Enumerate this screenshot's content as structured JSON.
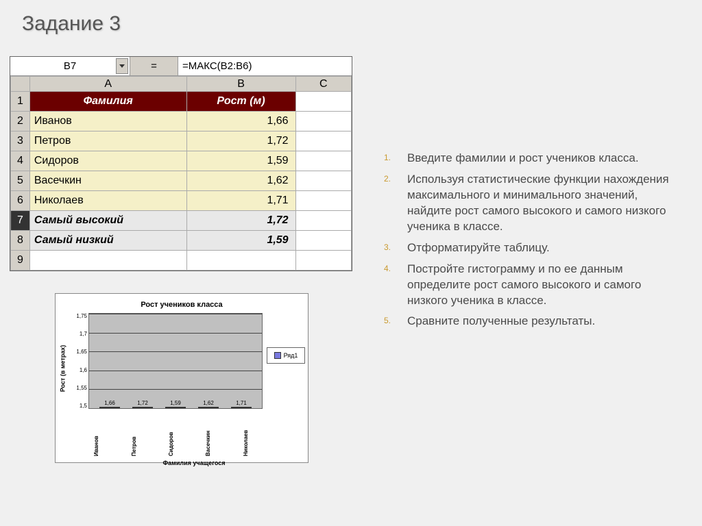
{
  "title": "Задание 3",
  "excel": {
    "active_cell": "B7",
    "eq_sign": "=",
    "formula": "=МАКС(B2:B6)",
    "cols": [
      "A",
      "B",
      "C"
    ],
    "header": {
      "A": "Фамилия",
      "B": "Рост (м)"
    },
    "rows": [
      {
        "num": "1"
      },
      {
        "num": "2",
        "A": "Иванов",
        "B": "1,66"
      },
      {
        "num": "3",
        "A": "Петров",
        "B": "1,72"
      },
      {
        "num": "4",
        "A": "Сидоров",
        "B": "1,59"
      },
      {
        "num": "5",
        "A": "Васечкин",
        "B": "1,62"
      },
      {
        "num": "6",
        "A": "Николаев",
        "B": "1,71"
      },
      {
        "num": "7",
        "A": "Самый высокий",
        "B": "1,72",
        "summary": true,
        "selected": true
      },
      {
        "num": "8",
        "A": "Самый низкий",
        "B": "1,59",
        "summary": true
      },
      {
        "num": "9"
      }
    ]
  },
  "instructions": [
    "Введите фамилии и рост учеников класса.",
    "Используя статистические функции нахождения максимального и минимального значений, найдите рост самого высокого и самого низкого ученика в классе.",
    "Отформатируйте таблицу.",
    "Постройте гистограмму и по ее данным определите рост самого высокого и самого низкого ученика в классе.",
    "Сравните полученные результаты."
  ],
  "instruction_nums": [
    "1.",
    "2.",
    "3.",
    "4.",
    "5."
  ],
  "chart_data": {
    "type": "bar",
    "title": "Рост учеников класса",
    "xlabel": "Фамилия учащегося",
    "ylabel": "Рост (в метрах)",
    "ylim": [
      1.5,
      1.75
    ],
    "yticks": [
      "1,75",
      "1,7",
      "1,65",
      "1,6",
      "1,55",
      "1,5"
    ],
    "categories": [
      "Иванов",
      "Петров",
      "Сидоров",
      "Васечкин",
      "Николаев"
    ],
    "values": [
      1.66,
      1.72,
      1.59,
      1.62,
      1.71
    ],
    "value_labels": [
      "1,66",
      "1,72",
      "1,59",
      "1,62",
      "1,71"
    ],
    "legend": "Ряд1"
  }
}
